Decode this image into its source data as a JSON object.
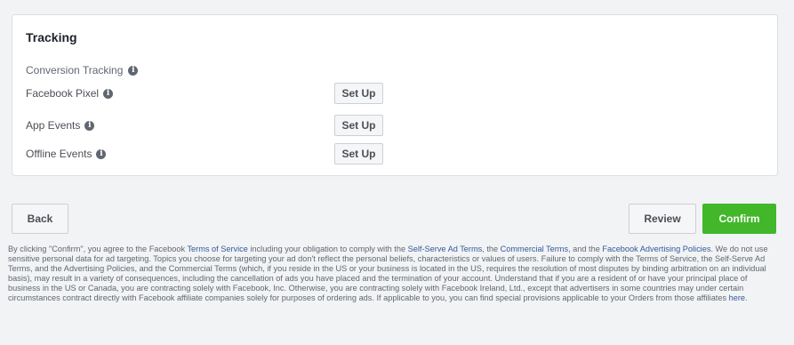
{
  "tracking": {
    "title": "Tracking",
    "conversion_label": "Conversion Tracking",
    "rows": [
      {
        "label": "Facebook Pixel",
        "button": "Set Up"
      },
      {
        "label": "App Events",
        "button": "Set Up"
      },
      {
        "label": "Offline Events",
        "button": "Set Up"
      }
    ]
  },
  "footer": {
    "back_label": "Back",
    "review_label": "Review",
    "confirm_label": "Confirm",
    "confirm_color": "#42b72a"
  },
  "legal": {
    "t1": "By clicking \"Confirm\", you agree to the Facebook ",
    "link_tos": "Terms of Service",
    "t2": " including your obligation to comply with the ",
    "link_self_serve": "Self-Serve Ad Terms",
    "t3": ", the ",
    "link_commercial": "Commercial Terms",
    "t4": ", and the ",
    "link_ad_policies": "Facebook Advertising Policies",
    "t5": ". We do not use sensitive personal data for ad targeting. Topics you choose for targeting your ad don't reflect the personal beliefs, characteristics or values of users. Failure to comply with the Terms of Service, the Self-Serve Ad Terms, and the Advertising Policies, and the Commercial Terms (which, if you reside in the US or your business is located in the US, requires the resolution of most disputes by binding arbitration on an individual basis), may result in a variety of consequences, including the cancellation of ads you have placed and the termination of your account. Understand that if you are a resident of or have your principal place of business in the US or Canada, you are contracting solely with Facebook, Inc. Otherwise, you are contracting solely with Facebook Ireland, Ltd., except that advertisers in some countries may under certain circumstances contract directly with Facebook affiliate companies solely for purposes of ordering ads. If applicable to you, you can find special provisions applicable to your Orders from those affiliates ",
    "link_here": "here",
    "t6": "."
  },
  "colors": {
    "link": "#365899",
    "background": "#f2f3f5"
  }
}
